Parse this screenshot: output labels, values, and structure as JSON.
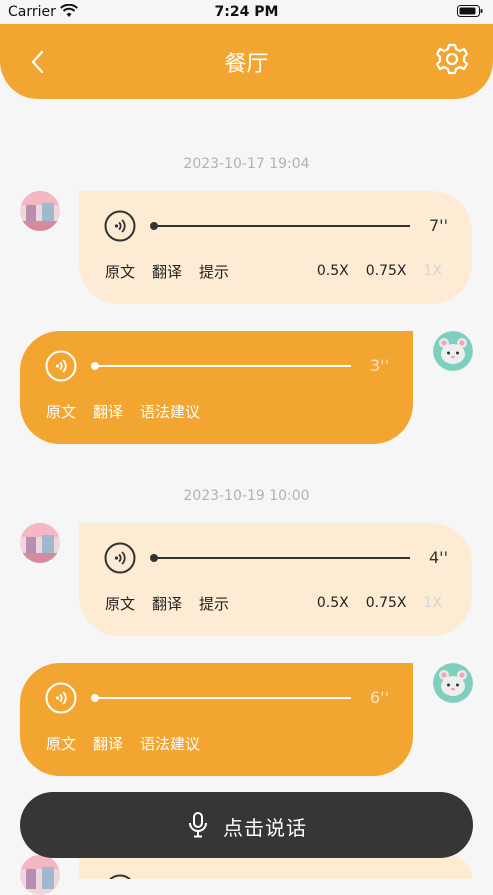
{
  "status_bar": {
    "carrier": "Carrier",
    "time": "7:24 PM"
  },
  "header": {
    "title": "餐厅",
    "back_icon": "chevron-left-icon",
    "settings_icon": "gear-icon"
  },
  "messages": [
    {
      "timestamp": "2023-10-17 19:04",
      "side": "left",
      "duration": "7''",
      "progress": 0,
      "actions": [
        "原文",
        "翻译",
        "提示"
      ],
      "speeds": [
        "0.5X",
        "0.75X",
        "1X"
      ],
      "active_speed": "1X"
    },
    {
      "side": "right",
      "duration": "3''",
      "progress": 0,
      "actions": [
        "原文",
        "翻译",
        "语法建议"
      ]
    },
    {
      "timestamp": "2023-10-19 10:00",
      "side": "left",
      "duration": "4''",
      "progress": 0,
      "actions": [
        "原文",
        "翻译",
        "提示"
      ],
      "speeds": [
        "0.5X",
        "0.75X",
        "1X"
      ],
      "active_speed": "1X"
    },
    {
      "side": "right",
      "duration": "6''",
      "progress": 0,
      "actions": [
        "原文",
        "翻译",
        "语法建议"
      ]
    }
  ],
  "talk_button": {
    "label": "点击说话",
    "icon": "microphone-icon"
  },
  "colors": {
    "accent": "#f2a531",
    "bubble_light": "#fdebd3",
    "talk_button": "#363636",
    "background": "#f6f6f6"
  }
}
